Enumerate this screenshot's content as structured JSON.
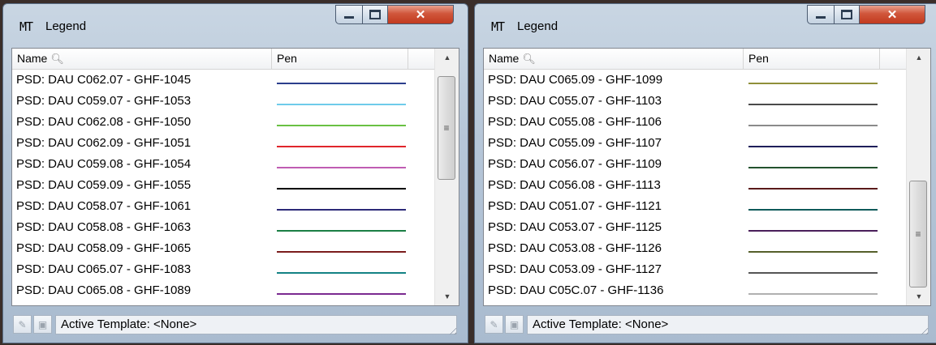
{
  "windows": [
    {
      "title_logo": "MT",
      "title": "Legend",
      "columns": {
        "name": "Name",
        "pen": "Pen"
      },
      "rows": [
        {
          "name": "PSD: DAU C062.07 - GHF-1045",
          "pen_color": "#2b3e8c"
        },
        {
          "name": "PSD: DAU C059.07 - GHF-1053",
          "pen_color": "#6ecbea"
        },
        {
          "name": "PSD: DAU C062.08 - GHF-1050",
          "pen_color": "#6ac143"
        },
        {
          "name": "PSD: DAU C062.09 - GHF-1051",
          "pen_color": "#e0262b"
        },
        {
          "name": "PSD: DAU C059.08 - GHF-1054",
          "pen_color": "#c05db3"
        },
        {
          "name": "PSD: DAU C059.09 - GHF-1055",
          "pen_color": "#000000"
        },
        {
          "name": "PSD: DAU C058.07 - GHF-1061",
          "pen_color": "#2c2a78"
        },
        {
          "name": "PSD: DAU C058.08 - GHF-1063",
          "pen_color": "#1a7f45"
        },
        {
          "name": "PSD: DAU C058.09 - GHF-1065",
          "pen_color": "#7b1c1c"
        },
        {
          "name": "PSD: DAU C065.07 - GHF-1083",
          "pen_color": "#138284"
        },
        {
          "name": "PSD: DAU C065.08 - GHF-1089",
          "pen_color": "#7a2a90"
        }
      ],
      "status": "Active Template: <None>"
    },
    {
      "title_logo": "MT",
      "title": "Legend",
      "columns": {
        "name": "Name",
        "pen": "Pen"
      },
      "rows": [
        {
          "name": "PSD: DAU C065.09 - GHF-1099",
          "pen_color": "#8f8f3a"
        },
        {
          "name": "PSD: DAU C055.07 - GHF-1103",
          "pen_color": "#4a4a4a"
        },
        {
          "name": "PSD: DAU C055.08 - GHF-1106",
          "pen_color": "#8a8a8a"
        },
        {
          "name": "PSD: DAU C055.09 - GHF-1107",
          "pen_color": "#1e1e5a"
        },
        {
          "name": "PSD: DAU C056.07 - GHF-1109",
          "pen_color": "#23522e"
        },
        {
          "name": "PSD: DAU C056.08 - GHF-1113",
          "pen_color": "#5a1a1a"
        },
        {
          "name": "PSD: DAU C051.07 - GHF-1121",
          "pen_color": "#0f5a5a"
        },
        {
          "name": "PSD: DAU C053.07 - GHF-1125",
          "pen_color": "#4a1e5a"
        },
        {
          "name": "PSD: DAU C053.08 - GHF-1126",
          "pen_color": "#55602a"
        },
        {
          "name": "PSD: DAU C053.09 - GHF-1127",
          "pen_color": "#555555"
        },
        {
          "name": "PSD: DAU C05C.07 - GHF-1136",
          "pen_color": "#b0b0b0"
        }
      ],
      "status": "Active Template: <None>"
    }
  ],
  "icons": {
    "search": "magnifier-icon",
    "minimize": "minimize-icon",
    "maximize": "maximize-icon",
    "close": "close-icon",
    "template": "template-icon",
    "save": "save-icon",
    "grip": "resize-grip-icon"
  }
}
